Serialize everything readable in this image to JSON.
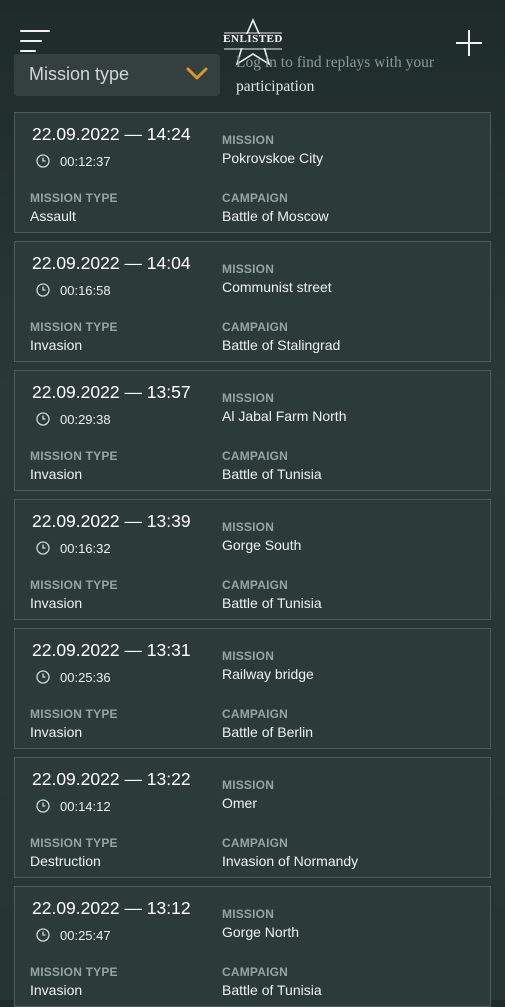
{
  "header": {
    "logo_text": "ENLISTED",
    "filter": {
      "label": "Mission type"
    },
    "login_hint": {
      "line1": "Log in to find replays with your",
      "line2": "participation"
    }
  },
  "labels": {
    "mission": "MISSION",
    "mission_type": "MISSION TYPE",
    "campaign": "CAMPAIGN"
  },
  "replays": [
    {
      "datetime": "22.09.2022 — 14:24",
      "duration": "00:12:37",
      "mission": "Pokrovskoe City",
      "mission_type": "Assault",
      "campaign": "Battle of Moscow"
    },
    {
      "datetime": "22.09.2022 — 14:04",
      "duration": "00:16:58",
      "mission": "Communist street",
      "mission_type": "Invasion",
      "campaign": "Battle of Stalingrad"
    },
    {
      "datetime": "22.09.2022 — 13:57",
      "duration": "00:29:38",
      "mission": "Al Jabal Farm North",
      "mission_type": "Invasion",
      "campaign": "Battle of Tunisia"
    },
    {
      "datetime": "22.09.2022 — 13:39",
      "duration": "00:16:32",
      "mission": "Gorge South",
      "mission_type": "Invasion",
      "campaign": "Battle of Tunisia"
    },
    {
      "datetime": "22.09.2022 — 13:31",
      "duration": "00:25:36",
      "mission": "Railway bridge",
      "mission_type": "Invasion",
      "campaign": "Battle of Berlin"
    },
    {
      "datetime": "22.09.2022 — 13:22",
      "duration": "00:14:12",
      "mission": "Omer",
      "mission_type": "Destruction",
      "campaign": "Invasion of Normandy"
    },
    {
      "datetime": "22.09.2022 — 13:12",
      "duration": "00:25:47",
      "mission": "Gorge North",
      "mission_type": "Invasion",
      "campaign": "Battle of Tunisia"
    }
  ],
  "colors": {
    "background": "#23302f",
    "card": "#2c3a3a",
    "card_border": "#4e5d5c",
    "accent": "#d99a1e",
    "muted_label": "#97a4a3"
  },
  "icons": {
    "menu": "hamburger-icon",
    "add": "plus-icon",
    "dropdown": "chevron-down-icon",
    "duration": "clock-icon",
    "logo": "star-logo"
  }
}
